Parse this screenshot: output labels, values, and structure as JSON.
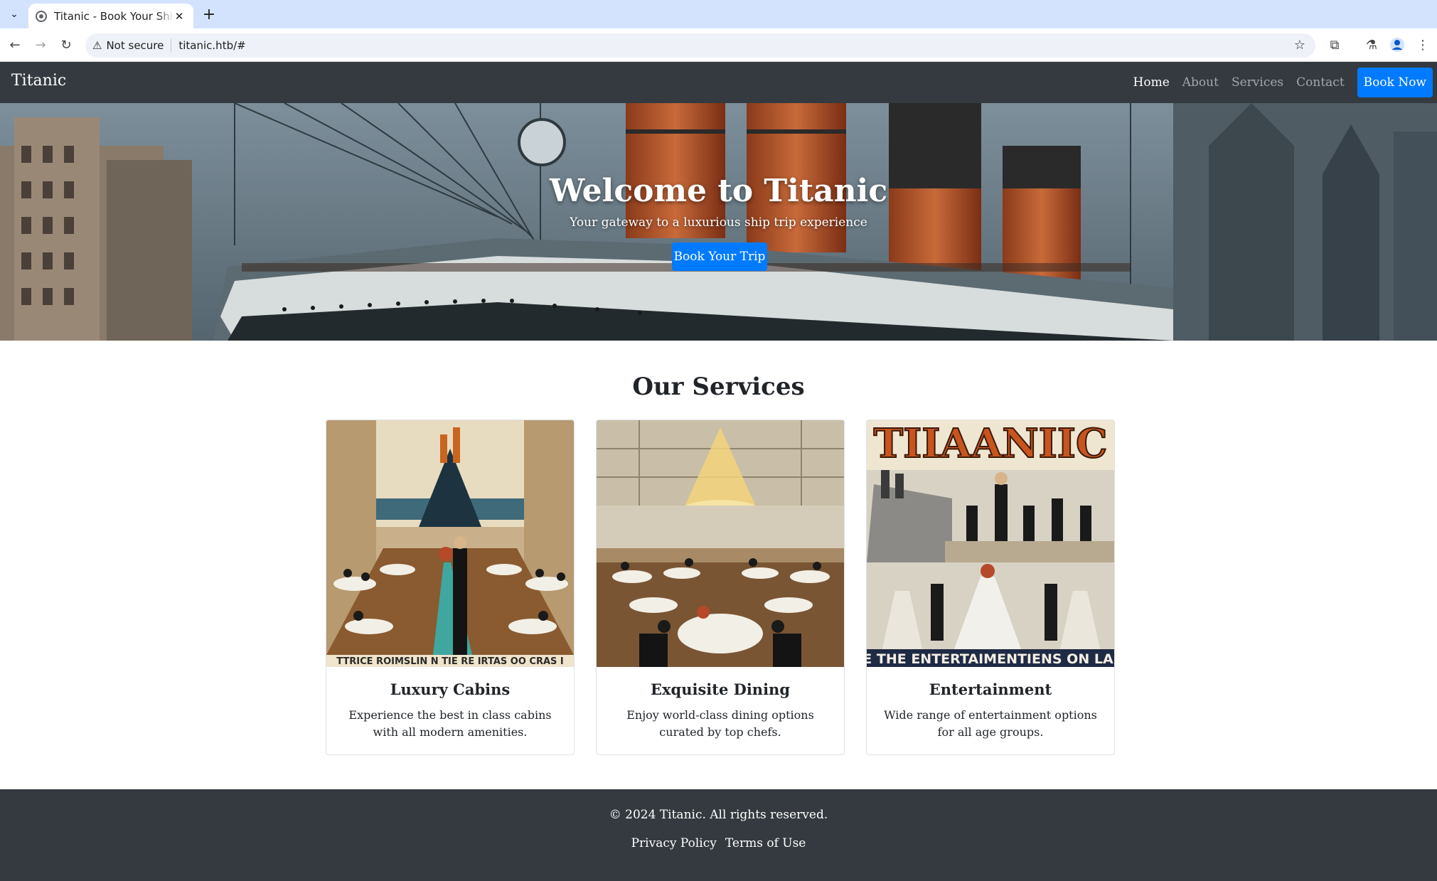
{
  "browser": {
    "tab_title": "Titanic - Book Your Ship Trip",
    "close_glyph": "✕",
    "new_tab_glyph": "+",
    "security_label": "Not secure",
    "url": "titanic.htb/#"
  },
  "navbar": {
    "brand": "Titanic",
    "links": [
      "Home",
      "About",
      "Services",
      "Contact"
    ],
    "cta": "Book Now"
  },
  "hero": {
    "title": "Welcome to Titanic",
    "subtitle": "Your gateway to a luxurious ship trip experience",
    "button": "Book Your Trip"
  },
  "services": {
    "title": "Our Services",
    "cards": [
      {
        "title": "Luxury Cabins",
        "text": "Experience the best in class cabins with all modern amenities.",
        "image_caption": "TTRICE ROIMSLIN N TIE RE IRTAS OO CRAS I"
      },
      {
        "title": "Exquisite Dining",
        "text": "Enjoy world-class dining options curated by top chefs."
      },
      {
        "title": "Entertainment",
        "text": "Wide range of entertainment options for all age groups.",
        "image_heading": "TIIAANIIC",
        "image_caption": "E THE ENTERTAIMENTIENS ON LAI"
      }
    ]
  },
  "footer": {
    "copyright": "© 2024 Titanic. All rights reserved.",
    "links": [
      "Privacy Policy",
      "Terms of Use"
    ]
  },
  "colors": {
    "navbar_bg": "#343a40",
    "accent": "#007bff",
    "tabstrip_bg": "#d3e3fd"
  }
}
